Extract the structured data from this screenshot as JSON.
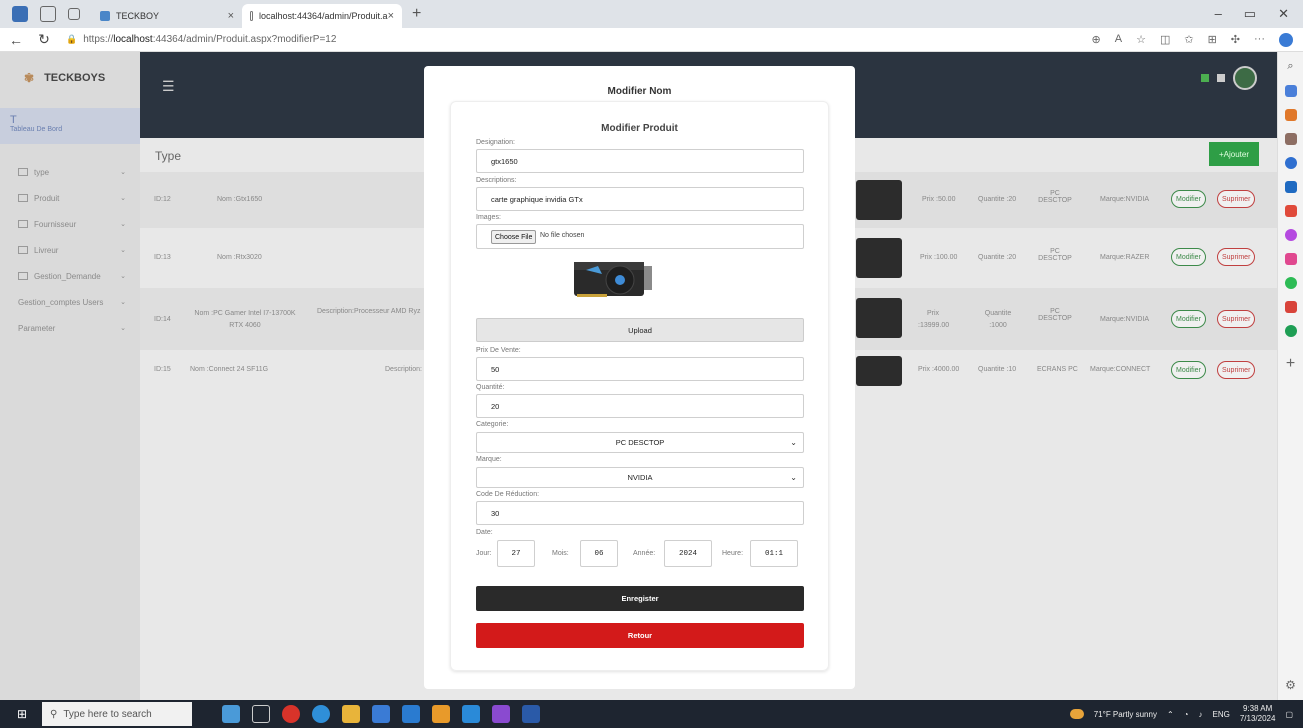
{
  "browser": {
    "tab_inactive": "TECKBOY",
    "tab_active": "localhost:44364/admin/Produit.a",
    "url_prefix": "https://",
    "url_host": "localhost",
    "url_rest": ":44364/admin/Produit.aspx?modifierP=12"
  },
  "sidebar": {
    "brand": "TECKBOYS",
    "dashboard_icon": "T",
    "dashboard_label": "Tableau De Bord",
    "items": [
      {
        "label": "type"
      },
      {
        "label": "Produit"
      },
      {
        "label": "Fournisseur"
      },
      {
        "label": "Livreur"
      },
      {
        "label": "Gestion_Demande"
      }
    ],
    "item_users": "Gestion_comptes Users",
    "item_params": "Parameter"
  },
  "page": {
    "heading": "Type",
    "add_button": "+Ajouter",
    "rows": [
      {
        "id": "ID:12",
        "nom": "Nom :Gtx1650",
        "prix": "Prix :50.00",
        "qte": "Quantite :20",
        "cat": "PC DESCTOP",
        "marque": "Marque:NVIDIA"
      },
      {
        "id": "ID:13",
        "nom": "Nom :Rtx3020",
        "prix": "Prix :100.00",
        "qte": "Quantite :20",
        "cat": "PC DESCTOP",
        "marque": "Marque:RAZER"
      },
      {
        "id": "ID:14",
        "nom": "Nom :PC Gamer Intel I7-13700K RTX 4060",
        "desc": "Description:Processeur AMD Ryz",
        "prix": "Prix :13999.00",
        "qte": "Quantite :1000",
        "cat": "PC DESCTOP",
        "marque": "Marque:NVIDIA"
      },
      {
        "id": "ID:15",
        "nom": "Nom :Connect 24 SF11G",
        "desc": "Description:",
        "prix": "Prix :4000.00",
        "qte": "Quantite :10",
        "cat": "ECRANS PC",
        "marque": "Marque:CONNECT"
      }
    ],
    "modify_label": "Modifier",
    "delete_label": "Suprimer"
  },
  "modal": {
    "title": "Modifier Nom",
    "card_title": "Modifier Produit",
    "designation_label": "Designation:",
    "designation_value": "gtx1650",
    "descriptions_label": "Descriptions:",
    "descriptions_value": "carte graphique invidia GTx",
    "images_label": "Images:",
    "file_button": "Choose File",
    "file_status": "No file chosen",
    "upload_button": "Upload",
    "prix_label": "Prix De Vente:",
    "prix_value": "50",
    "quantite_label": "Quantité:",
    "quantite_value": "20",
    "categorie_label": "Categorie:",
    "categorie_value": "PC DESCTOP",
    "marque_label": "Marque:",
    "marque_value": "NVIDIA",
    "reduction_label": "Code De Réduction:",
    "reduction_value": "30",
    "date_label": "Date:",
    "jour_label": "Jour:",
    "jour_value": "27",
    "mois_label": "Mois:",
    "mois_value": "06",
    "annee_label": "Année:",
    "annee_value": "2024",
    "heure_label": "Heure:",
    "heure_value": "01:1",
    "save_button": "Enregister",
    "back_button": "Retour"
  },
  "taskbar": {
    "search_placeholder": "Type here to search",
    "weather": "71°F  Partly sunny",
    "lang": "ENG",
    "time": "9:38 AM",
    "date": "7/13/2024"
  },
  "colors": {
    "nav_dark": "#2b3440",
    "add_green": "#2e9e46",
    "save_black": "#2a2a2a",
    "back_red": "#d31a1a"
  }
}
